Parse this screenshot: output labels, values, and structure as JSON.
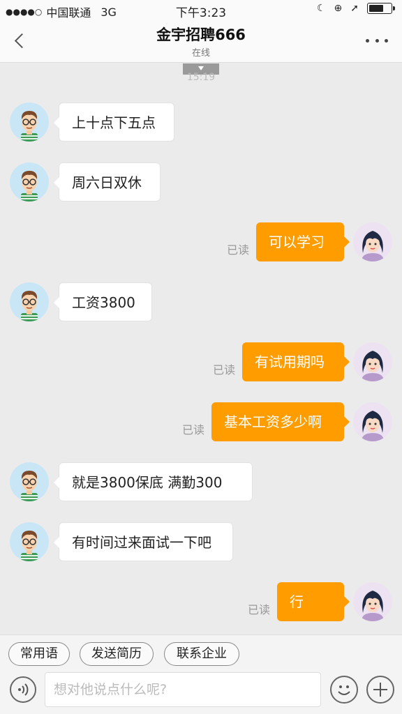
{
  "status_bar": {
    "signal": "●●●●○",
    "carrier": "中国联通",
    "network": "3G",
    "time": "下午3:23",
    "icons": [
      "moon-icon",
      "orientation-lock-icon",
      "location-arrow-icon",
      "battery-icon"
    ]
  },
  "nav": {
    "title": "金宇招聘666",
    "subtitle": "在线"
  },
  "chat": {
    "timestamp": "15:19",
    "read_label": "已读",
    "messages": [
      {
        "side": "left",
        "text": "上十点下五点"
      },
      {
        "side": "left",
        "text": "周六日双休"
      },
      {
        "side": "right",
        "text": "可以学习",
        "status": "已读"
      },
      {
        "side": "left",
        "text": "工资3800"
      },
      {
        "side": "right",
        "text": "有试用期吗",
        "status": "已读"
      },
      {
        "side": "right",
        "text": "基本工资多少啊",
        "status": "已读"
      },
      {
        "side": "left",
        "text": "就是3800保底    满勤300"
      },
      {
        "side": "left",
        "text": "有时间过来面试一下吧"
      },
      {
        "side": "right",
        "text": "行",
        "status": "已读"
      }
    ]
  },
  "quick_replies": [
    "常用语",
    "发送简历",
    "联系企业"
  ],
  "input": {
    "placeholder": "想对他说点什么呢?"
  },
  "colors": {
    "accent": "#ff9d00",
    "background": "#ebebeb"
  }
}
